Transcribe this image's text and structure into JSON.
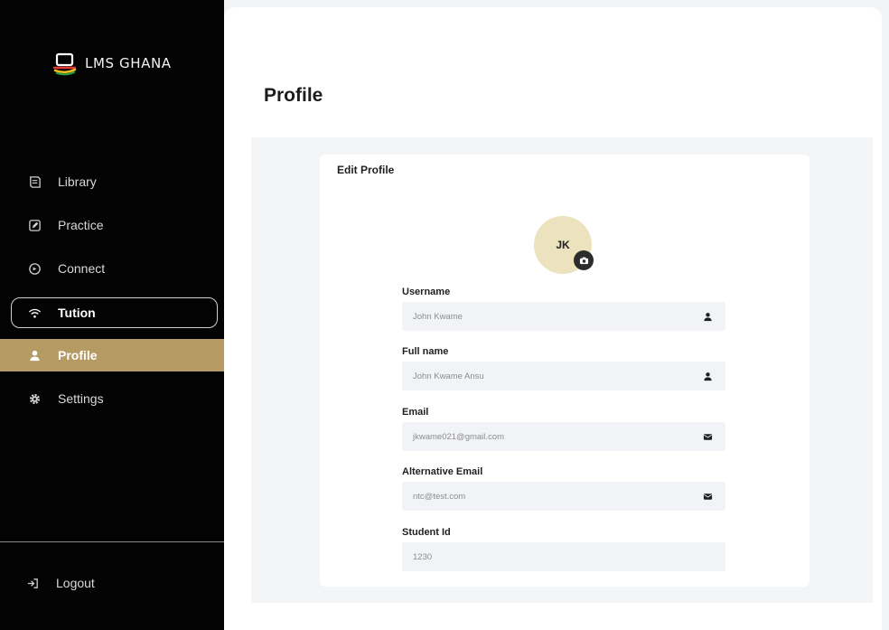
{
  "app": {
    "brand": "LMS GHANA"
  },
  "sidebar": {
    "items": [
      {
        "label": "Library",
        "icon": "book-icon"
      },
      {
        "label": "Practice",
        "icon": "pen-square-icon"
      },
      {
        "label": "Connect",
        "icon": "chat-bubble-icon"
      },
      {
        "label": "Tution",
        "icon": "wifi-icon"
      },
      {
        "label": "Profile",
        "icon": "user-icon"
      },
      {
        "label": "Settings",
        "icon": "gear-icon"
      }
    ],
    "active_item": "Profile",
    "logout_label": "Logout",
    "active_color": "#b59a63"
  },
  "page": {
    "title": "Profile"
  },
  "card": {
    "title": "Edit Profile",
    "avatar_initials": "JK",
    "fields": [
      {
        "label": "Username",
        "value": "John Kwame",
        "icon": "user-icon"
      },
      {
        "label": "Full name",
        "value": "John Kwame Ansu",
        "icon": "user-icon"
      },
      {
        "label": "Email",
        "value": "jkwame021@gmail.com",
        "icon": "envelope-icon"
      },
      {
        "label": "Alternative Email",
        "value": "ntc@test.com",
        "icon": "envelope-icon"
      },
      {
        "label": "Student Id",
        "value": "1230",
        "icon": ""
      }
    ]
  }
}
